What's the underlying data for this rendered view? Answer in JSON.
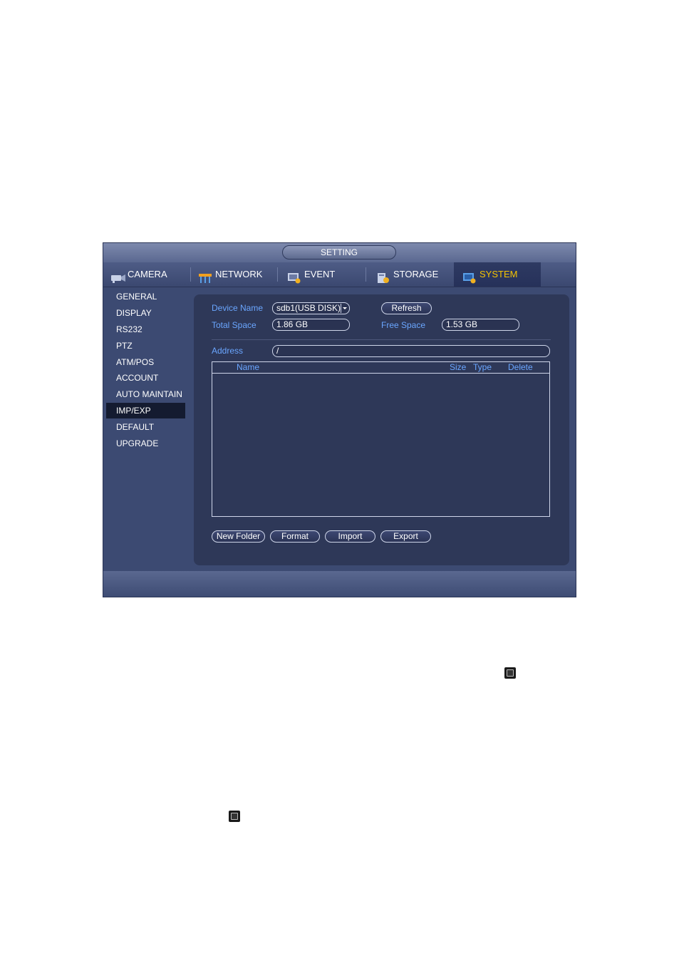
{
  "window": {
    "title": "SETTING"
  },
  "tabs": [
    {
      "label": "CAMERA",
      "icon": "camera-icon"
    },
    {
      "label": "NETWORK",
      "icon": "network-icon"
    },
    {
      "label": "EVENT",
      "icon": "event-icon"
    },
    {
      "label": "STORAGE",
      "icon": "storage-icon"
    },
    {
      "label": "SYSTEM",
      "icon": "system-icon",
      "active": true
    }
  ],
  "sidebar": {
    "items": [
      {
        "label": "GENERAL"
      },
      {
        "label": "DISPLAY"
      },
      {
        "label": "RS232"
      },
      {
        "label": "PTZ"
      },
      {
        "label": "ATM/POS"
      },
      {
        "label": "ACCOUNT"
      },
      {
        "label": "AUTO MAINTAIN"
      },
      {
        "label": "IMP/EXP",
        "active": true
      },
      {
        "label": "DEFAULT"
      },
      {
        "label": "UPGRADE"
      }
    ]
  },
  "form": {
    "device_name_label": "Device Name",
    "device_name_value": "sdb1(USB DISK)",
    "refresh_label": "Refresh",
    "total_space_label": "Total Space",
    "total_space_value": "1.86 GB",
    "free_space_label": "Free Space",
    "free_space_value": "1.53 GB",
    "address_label": "Address",
    "address_value": "/"
  },
  "file_list": {
    "columns": {
      "name": "Name",
      "size": "Size",
      "type": "Type",
      "delete": "Delete"
    },
    "rows": []
  },
  "actions": {
    "new_folder": "New Folder",
    "format": "Format",
    "import": "Import",
    "export": "Export"
  },
  "colors": {
    "accent_active_tab": "#f5c400",
    "label_blue": "#6aa6ff",
    "panel_bg": "#2e3858",
    "window_bg": "#3c4a72"
  },
  "page_icons": [
    "stop-icon",
    "stop-icon"
  ]
}
